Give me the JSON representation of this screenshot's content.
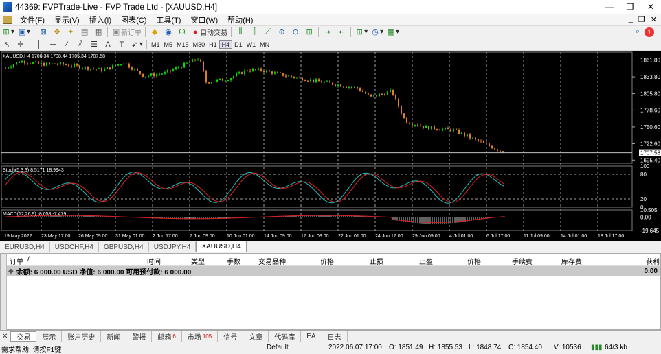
{
  "window": {
    "title": "44369: FVPTrade-Live - FVP Trade Ltd - [XAUUSD,H4]",
    "minimize": "—",
    "restore": "❐",
    "close": "✕"
  },
  "menu": {
    "items": [
      "文件(F)",
      "显示(V)",
      "插入(I)",
      "图表(C)",
      "工具(T)",
      "窗口(W)",
      "帮助(H)"
    ],
    "right": [
      "_",
      "❐",
      "✕"
    ]
  },
  "toolbar": {
    "new_order_label": "新订单",
    "auto_trade_label": "自动交易",
    "notification_count": "1"
  },
  "timeframes": [
    "M1",
    "M5",
    "M15",
    "M30",
    "H1",
    "H4",
    "D1",
    "W1",
    "MN"
  ],
  "chart": {
    "info_label": "XAUUSD,H4  1708.34 1708.44 1705.34 1707.58",
    "stoch_label": "Stoch(5,3,3) 8.5171 18.9943",
    "macd_label": "MACD(12,26,9) -8.058 -7.479",
    "price_ticks": [
      "1861.80",
      "1833.80",
      "1805.80",
      "1778.60",
      "1750.60",
      "1722.60",
      "1695.40"
    ],
    "current_price": "1707.58",
    "stoch_ticks": [
      "100",
      "80",
      "20",
      "0"
    ],
    "macd_ticks": [
      "10.505",
      "0.00",
      "-19.645"
    ],
    "time_ticks": [
      "19 May 2022",
      "23 May 17:00",
      "26 May 09:00",
      "31 May 01:00",
      "2 Jun 17:00",
      "7 Jun 09:00",
      "10 Jun 01:00",
      "14 Jun 09:00",
      "17 Jun 09:00",
      "22 Jun 01:00",
      "24 Jun 17:00",
      "29 Jun 09:00",
      "4 Jul 01:00",
      "6 Jul 17:00",
      "11 Jul 09:00",
      "14 Jul 01:00",
      "18 Jul 17:00"
    ],
    "colors": {
      "bull": "#00e000",
      "bear": "#e08020",
      "stoch_main": "#20c0c0",
      "stoch_signal": "#e02020",
      "macd_hist": "#c0c0c0",
      "macd_signal": "#e02020"
    }
  },
  "chart_tabs": [
    "EURUSD,H4",
    "USDCHF,H4",
    "GBPUSD,H4",
    "USDJPY,H4",
    "XAUUSD,H4"
  ],
  "terminal": {
    "columns": [
      "订单",
      "/",
      "时间",
      "类型",
      "手数",
      "交易品种",
      "价格",
      "止损",
      "止盈",
      "价格",
      "手续费",
      "库存费",
      "获利"
    ],
    "balance_row": "余额: 6 000.00 USD  净值: 6 000.00  可用预付款: 6 000.00",
    "balance_profit": "0.00",
    "side_label": "终端"
  },
  "terminal_tabs": [
    {
      "label": "交易",
      "badge": ""
    },
    {
      "label": "展示",
      "badge": ""
    },
    {
      "label": "账户历史",
      "badge": ""
    },
    {
      "label": "新闻",
      "badge": ""
    },
    {
      "label": "警报",
      "badge": ""
    },
    {
      "label": "邮箱",
      "badge": "6"
    },
    {
      "label": "市场",
      "badge": "105"
    },
    {
      "label": "信号",
      "badge": ""
    },
    {
      "label": "文章",
      "badge": ""
    },
    {
      "label": "代码库",
      "badge": ""
    },
    {
      "label": "EA",
      "badge": ""
    },
    {
      "label": "日志",
      "badge": ""
    }
  ],
  "status": {
    "help": "需求帮助, 请按F1键",
    "profile": "Default",
    "datetime": "2022.06.07 17:00",
    "open": "O: 1851.49",
    "high": "H: 1855.53",
    "low": "L: 1848.74",
    "close": "C: 1854.40",
    "volume": "V: 10536",
    "traffic": "64/3 kb"
  }
}
